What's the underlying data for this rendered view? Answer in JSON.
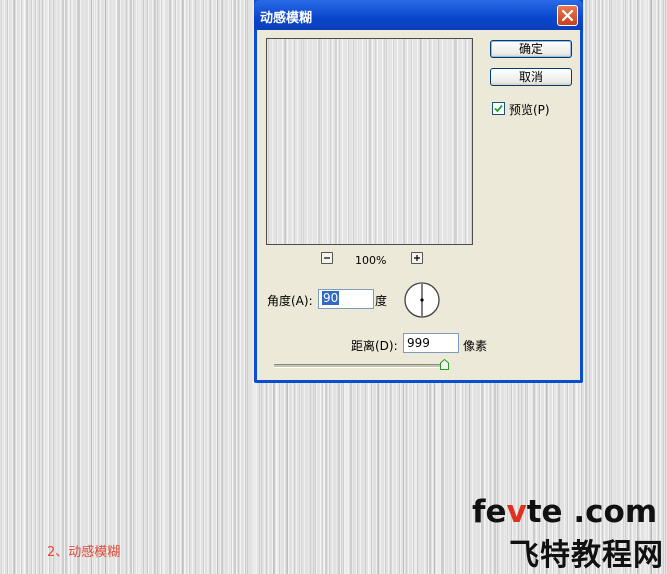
{
  "dialog": {
    "title": "动感模糊",
    "ok_label": "确定",
    "cancel_label": "取消",
    "preview_label": "预览(P)",
    "preview_checked": true,
    "zoom_value": "100%",
    "angle_label": "角度(A):",
    "angle_value": "90",
    "angle_unit": "度",
    "distance_label": "距离(D):",
    "distance_value": "999",
    "distance_unit": "像素",
    "distance_slider_fraction": 0.99
  },
  "caption": "2、动感模糊",
  "watermark": {
    "en_prefix": "fe",
    "en_highlight": "v",
    "en_suffix": "te .com",
    "cn": "飞特教程网"
  },
  "colors": {
    "titlebar": "#0a46cc",
    "dialog_face": "#ece9d8",
    "caption": "#e04a3a",
    "watermark_accent": "#e03020"
  }
}
